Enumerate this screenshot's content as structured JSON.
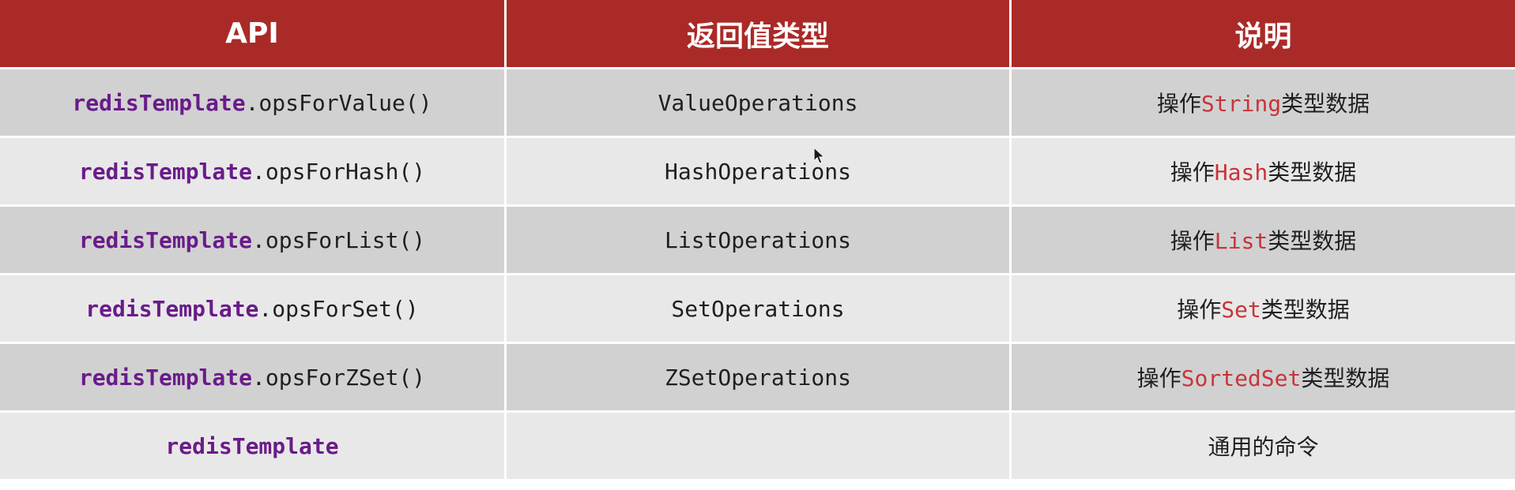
{
  "header": {
    "col_api": "API",
    "col_return": "返回值类型",
    "col_desc": "说明"
  },
  "rows": [
    {
      "api_obj": "redisTemplate",
      "api_method": ".opsForValue()",
      "return_type": "ValueOperations",
      "desc_prefix": "操作",
      "desc_type": "String",
      "desc_suffix": "类型数据"
    },
    {
      "api_obj": "redisTemplate",
      "api_method": ".opsForHash()",
      "return_type": "HashOperations",
      "desc_prefix": "操作",
      "desc_type": "Hash",
      "desc_suffix": "类型数据"
    },
    {
      "api_obj": "redisTemplate",
      "api_method": ".opsForList()",
      "return_type": "ListOperations",
      "desc_prefix": "操作",
      "desc_type": "List",
      "desc_suffix": "类型数据"
    },
    {
      "api_obj": "redisTemplate",
      "api_method": ".opsForSet()",
      "return_type": "SetOperations",
      "desc_prefix": "操作",
      "desc_type": "Set",
      "desc_suffix": "类型数据"
    },
    {
      "api_obj": "redisTemplate",
      "api_method": ".opsForZSet()",
      "return_type": "ZSetOperations",
      "desc_prefix": "操作",
      "desc_type": "SortedSet",
      "desc_suffix": "类型数据"
    },
    {
      "api_obj": "redisTemplate",
      "api_method": "",
      "return_type": "",
      "desc_prefix": "通用的命令",
      "desc_type": "",
      "desc_suffix": ""
    }
  ],
  "colors": {
    "header_bg": "#aa2a27",
    "row_dark": "#d1d1d1",
    "row_light": "#e8e8e8",
    "object_purple": "#6a1b8a",
    "type_red": "#c8343a"
  },
  "icons": {
    "cursor": "mouse-pointer-icon"
  }
}
